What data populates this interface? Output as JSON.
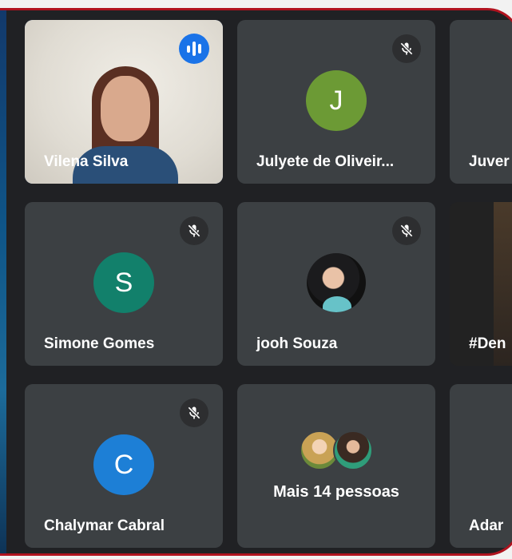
{
  "participants": [
    {
      "name": "Vilena Silva",
      "speaking": true
    },
    {
      "name": "Julyete de Oliveir...",
      "initial": "J",
      "avatar_color": "#6c9a35",
      "muted": true
    },
    {
      "name": "Juver",
      "muted": false
    },
    {
      "name": "Simone Gomes",
      "initial": "S",
      "avatar_color": "#12806b",
      "muted": true
    },
    {
      "name": "jooh Souza",
      "muted": true
    },
    {
      "name": "#Den",
      "muted": false
    },
    {
      "name": "Chalymar Cabral",
      "initial": "C",
      "avatar_color": "#1d7fd6",
      "muted": true
    },
    {
      "name": "Adar",
      "muted": false
    }
  ],
  "more": {
    "label": "Mais 14 pessoas"
  },
  "icons": {
    "speaking": "audio-level-icon",
    "muted": "mic-off-icon"
  },
  "colors": {
    "frame_border": "#b0131f",
    "tile": "#3c4043",
    "background": "#202124",
    "speaking_accent": "#1a73e8",
    "active_outline": "#8ab4f8"
  }
}
